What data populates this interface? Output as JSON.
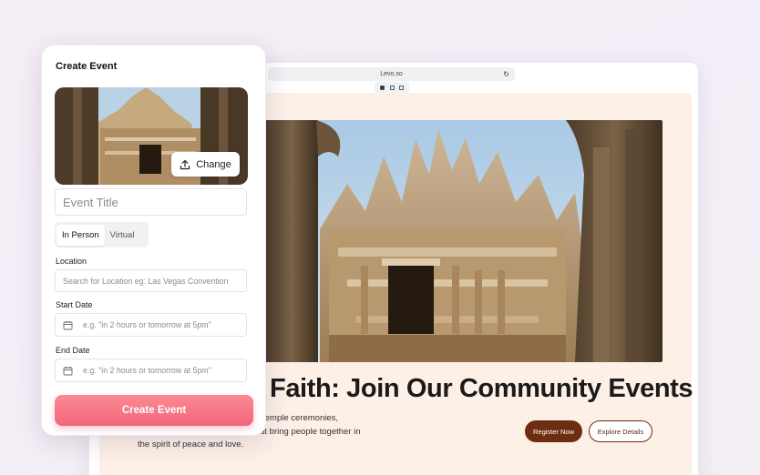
{
  "browser": {
    "url": "Levo.so",
    "reload_glyph": "↻"
  },
  "hero": {
    "title": "Faith: Join Our Community Events",
    "description_lines": [
      "n, and unity. Discover upcoming temple ceremonies,",
      "essions, and cultural festivals that bring people together in",
      "the spirit of peace and love."
    ],
    "register_label": "Register Now",
    "explore_label": "Explore Details"
  },
  "panel": {
    "title": "Create Event",
    "change_label": "Change",
    "event_title_placeholder": "Event Title",
    "tabs": [
      {
        "label": "In Person",
        "active": true
      },
      {
        "label": "Virtual",
        "active": false
      }
    ],
    "location_label": "Location",
    "location_placeholder": "Search for Location eg: Las Vegas Convention",
    "start_date_label": "Start Date",
    "start_date_placeholder": "e.g. \"in 2 hours or tomorrow at 5pm\"",
    "end_date_label": "End Date",
    "end_date_placeholder": "e.g. \"in 2 hours or tomorrow at 5pm\"",
    "create_label": "Create Event"
  },
  "colors": {
    "accent_gradient_top": "#fb8a93",
    "accent_gradient_bottom": "#f4667a",
    "register_bg": "#6e2c10",
    "hero_bg": "#fdf0e7"
  },
  "icons": [
    "upload-icon",
    "calendar-icon",
    "reload-icon",
    "device-icons"
  ]
}
